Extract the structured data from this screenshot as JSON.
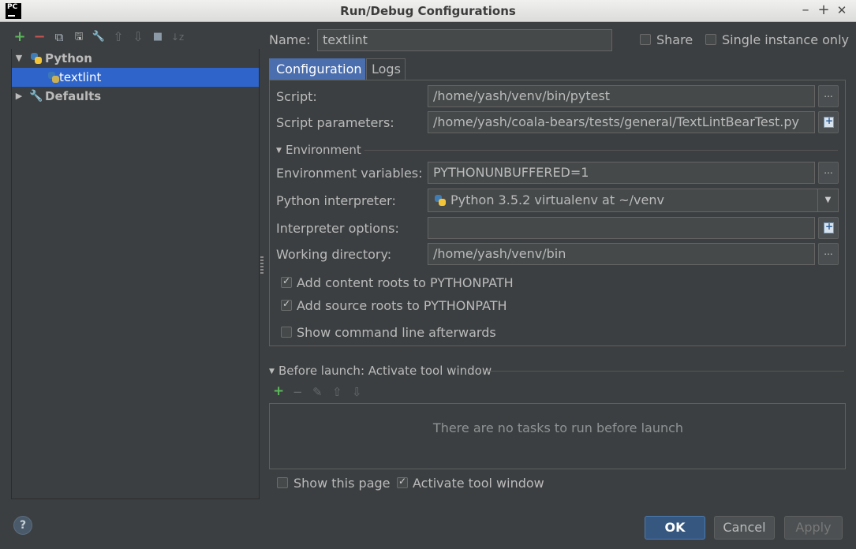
{
  "window": {
    "title": "Run/Debug Configurations",
    "app_logo": "PC",
    "controls": {
      "minimize": "–",
      "maximize": "+",
      "close": "✕"
    }
  },
  "left_toolbar": {
    "icons": [
      "add-icon",
      "remove-icon",
      "copy-icon",
      "save-icon",
      "edit-defaults-icon",
      "move-up-icon",
      "move-down-icon",
      "folder-icon",
      "sort-icon"
    ],
    "glyphs": {
      "add": "+",
      "remove": "−",
      "copy": "⧉",
      "save": "🖫",
      "edit": "🔧",
      "up": "⇧",
      "down": "⇩",
      "folder": "■",
      "sort": "↓z"
    }
  },
  "tree": {
    "python_label": "Python",
    "textlint_label": "textlint",
    "defaults_label": "Defaults",
    "expanded_arrow": "▼",
    "collapsed_arrow": "▶"
  },
  "header": {
    "name_label": "Name:",
    "name_value": "textlint",
    "share_label": "Share",
    "single_instance_label": "Single instance only",
    "share_checked": false,
    "single_instance_checked": false
  },
  "tabs": {
    "configuration": "Configuration",
    "logs": "Logs"
  },
  "config": {
    "script_label": "Script:",
    "script_value": "/home/yash/venv/bin/pytest",
    "script_params_label": "Script parameters:",
    "script_params_value": "/home/yash/coala-bears/tests/general/TextLintBearTest.py",
    "environment_section": "Environment",
    "env_vars_label": "Environment variables:",
    "env_vars_value": "PYTHONUNBUFFERED=1",
    "interpreter_label": "Python interpreter:",
    "interpreter_value": "Python 3.5.2 virtualenv at ~/venv",
    "interp_options_label": "Interpreter options:",
    "interp_options_value": "",
    "working_dir_label": "Working directory:",
    "working_dir_value": "/home/yash/venv/bin",
    "add_content_roots_label": "Add content roots to PYTHONPATH",
    "add_source_roots_label": "Add source roots to PYTHONPATH",
    "show_command_line_label": "Show command line afterwards",
    "browse_glyph": "...",
    "dropdown_glyph": "▼"
  },
  "before_launch": {
    "title": "Before launch: Activate tool window",
    "empty_message": "There are no tasks to run before launch",
    "toolbar": {
      "add": "+",
      "remove": "−",
      "edit": "✎",
      "up": "⇧",
      "down": "⇩"
    },
    "show_this_page_label": "Show this page",
    "activate_tool_window_label": "Activate tool window"
  },
  "footer": {
    "help": "?",
    "ok": "OK",
    "cancel": "Cancel",
    "apply": "Apply"
  },
  "colors": {
    "background": "#3c3f41",
    "selection": "#2f65ca",
    "active_tab": "#4b6eaf",
    "ok_button": "#365880",
    "add_green": "#5cb85c",
    "remove_red": "#c75450"
  }
}
